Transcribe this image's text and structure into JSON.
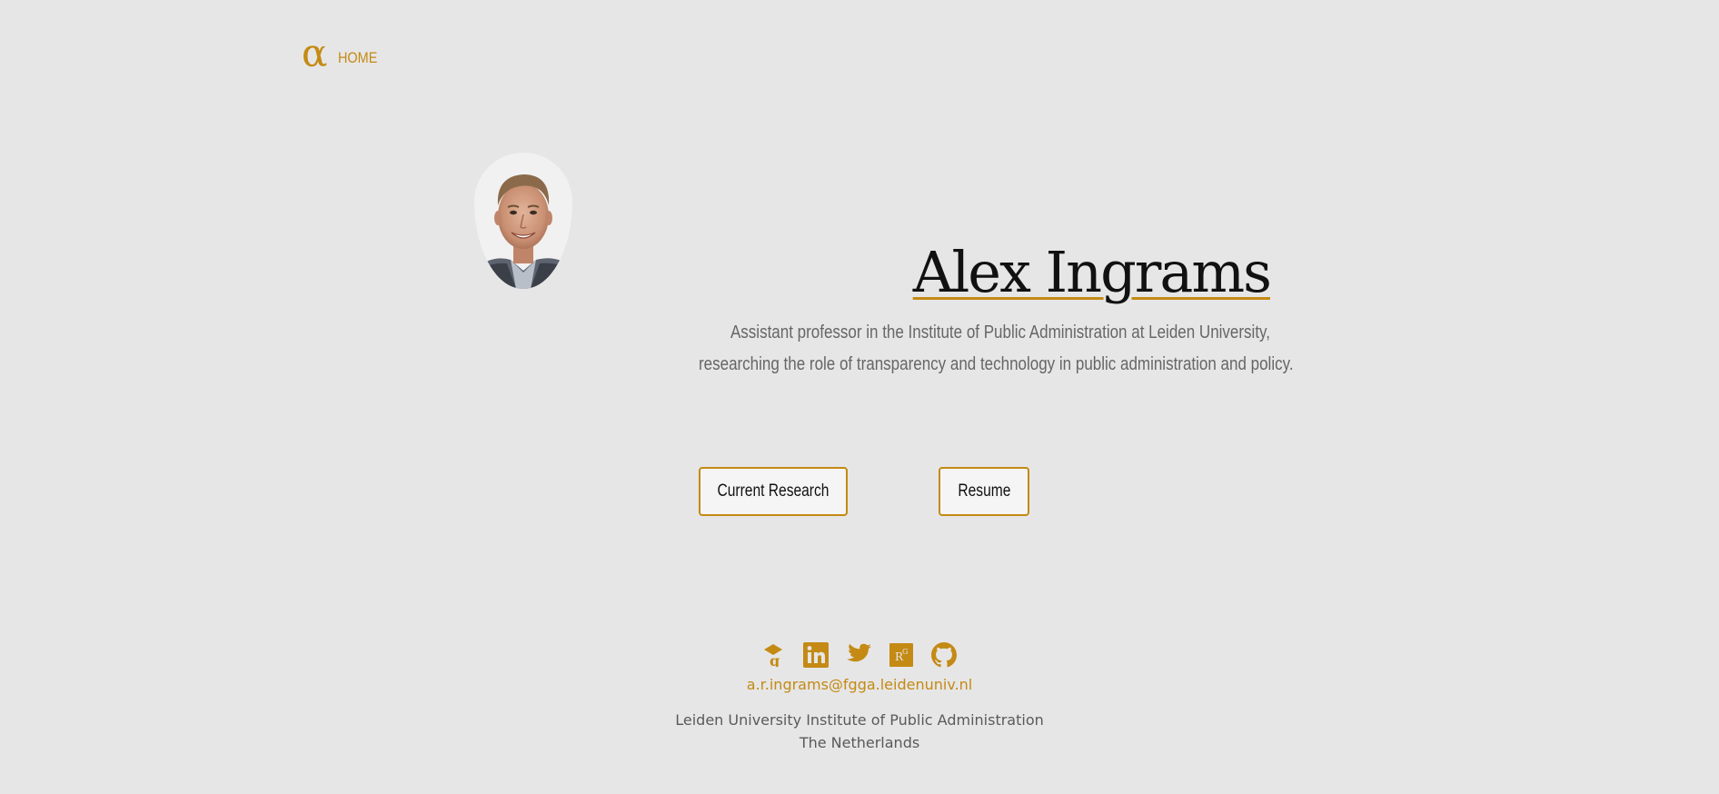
{
  "nav": {
    "logo_glyph": "α",
    "home_label": "HOME"
  },
  "hero": {
    "name": "Alex Ingrams",
    "tagline_line1": "Assistant professor in the Institute of Public Administration at Leiden University,",
    "tagline_line2": "researching the role of transparency and technology in public administration and policy."
  },
  "buttons": {
    "research_label": "Current Research",
    "resume_label": "Resume"
  },
  "footer": {
    "social_icons": [
      "google-scholar-icon",
      "linkedin-icon",
      "twitter-icon",
      "researchgate-icon",
      "github-icon"
    ],
    "email": "a.r.ingrams@fgga.leidenuniv.nl",
    "affiliation_line1": "Leiden University Institute of Public Administration",
    "affiliation_line2": "The Netherlands"
  },
  "colors": {
    "accent": "#c48a14",
    "background": "#e6e6e6",
    "text_dark": "#111111",
    "text_muted": "#666666"
  }
}
